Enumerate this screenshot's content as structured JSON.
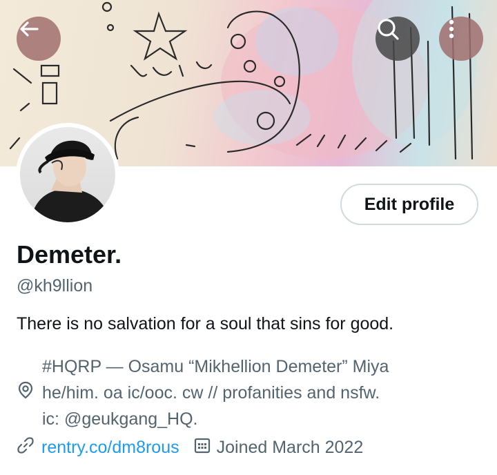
{
  "header": {
    "back_icon": "arrow-left-icon",
    "search_icon": "search-icon",
    "more_icon": "more-vertical-icon"
  },
  "profile": {
    "edit_label": "Edit profile",
    "display_name": "Demeter.",
    "handle": "@kh9llion",
    "bio": "There is no salvation for a soul that sins for good.",
    "location_lines": [
      "#HQRP — Osamu “Mikhellion Demeter” Miya",
      "he/him. oa ic/ooc. cw // profanities and nsfw.",
      "ic: @geukgang_HQ."
    ],
    "location_icon": "location-pin-icon",
    "website": "rentry.co/dm8rous",
    "website_icon": "link-icon",
    "joined": "Joined March 2022",
    "joined_icon": "calendar-icon"
  },
  "colors": {
    "link": "#1d9bf0",
    "secondary_text": "#536471",
    "primary_text": "#0f1419",
    "border": "#cfd9de"
  }
}
